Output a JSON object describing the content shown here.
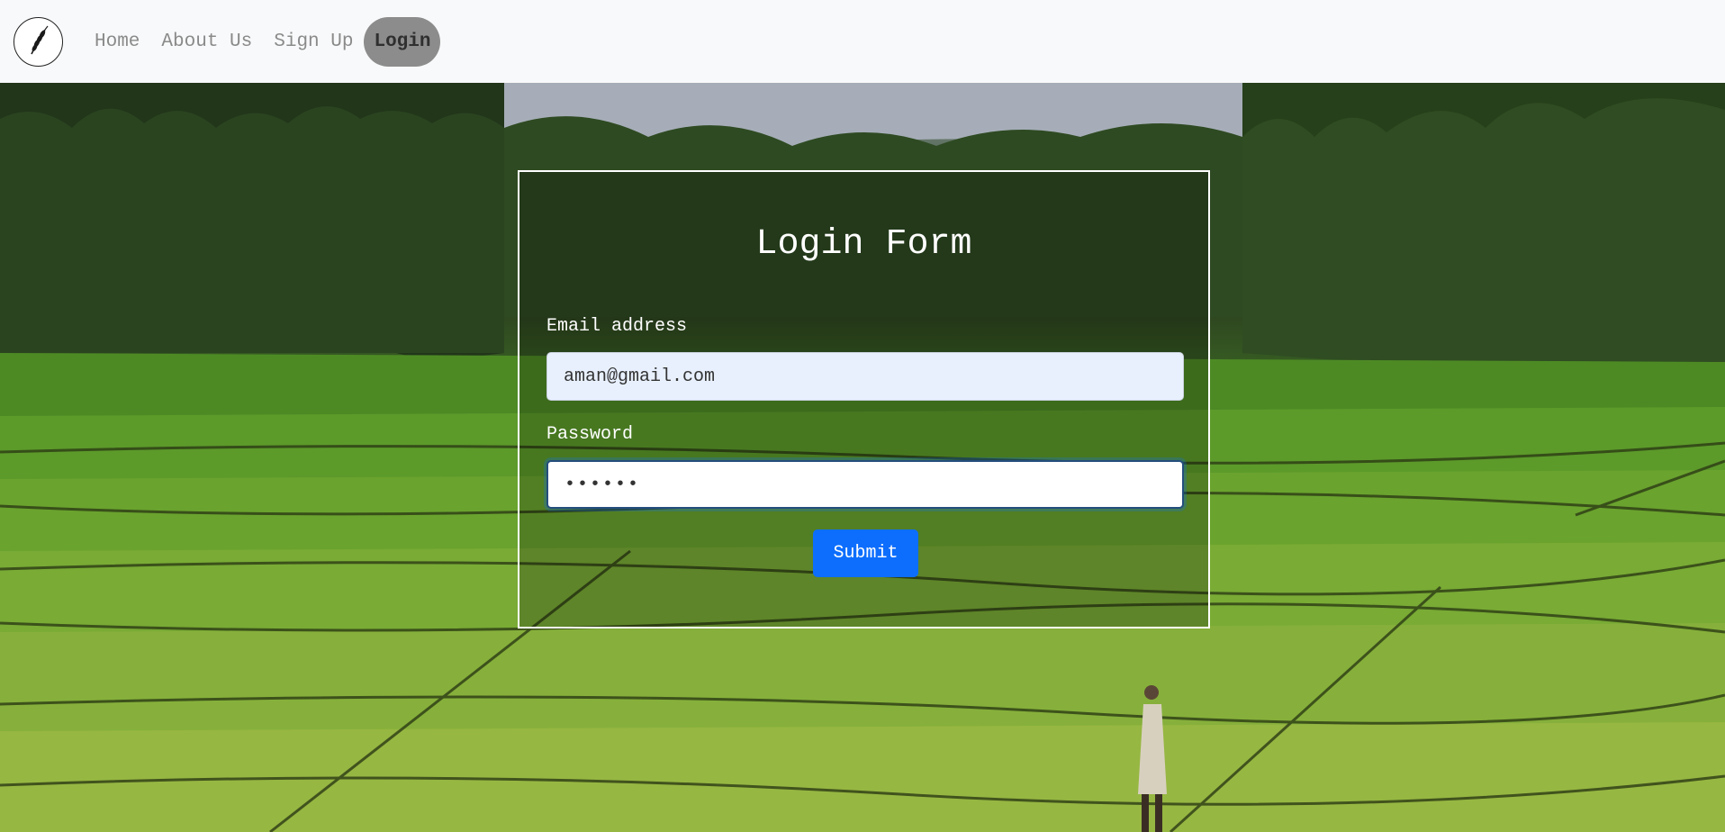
{
  "nav": {
    "logo_icon": "wheat-icon",
    "items": [
      {
        "label": "Home"
      },
      {
        "label": "About Us"
      },
      {
        "label": "Sign Up"
      },
      {
        "label": "Login",
        "active": true
      }
    ]
  },
  "form": {
    "title": "Login Form",
    "email_label": "Email address",
    "email_value": "aman@gmail.com",
    "password_label": "Password",
    "password_value": "••••••",
    "submit_label": "Submit"
  },
  "colors": {
    "navbar_bg": "#f8f9fa",
    "active_pill": "#8c8c8c",
    "submit": "#0d6efd",
    "email_autofill_bg": "#e8f0fe"
  }
}
